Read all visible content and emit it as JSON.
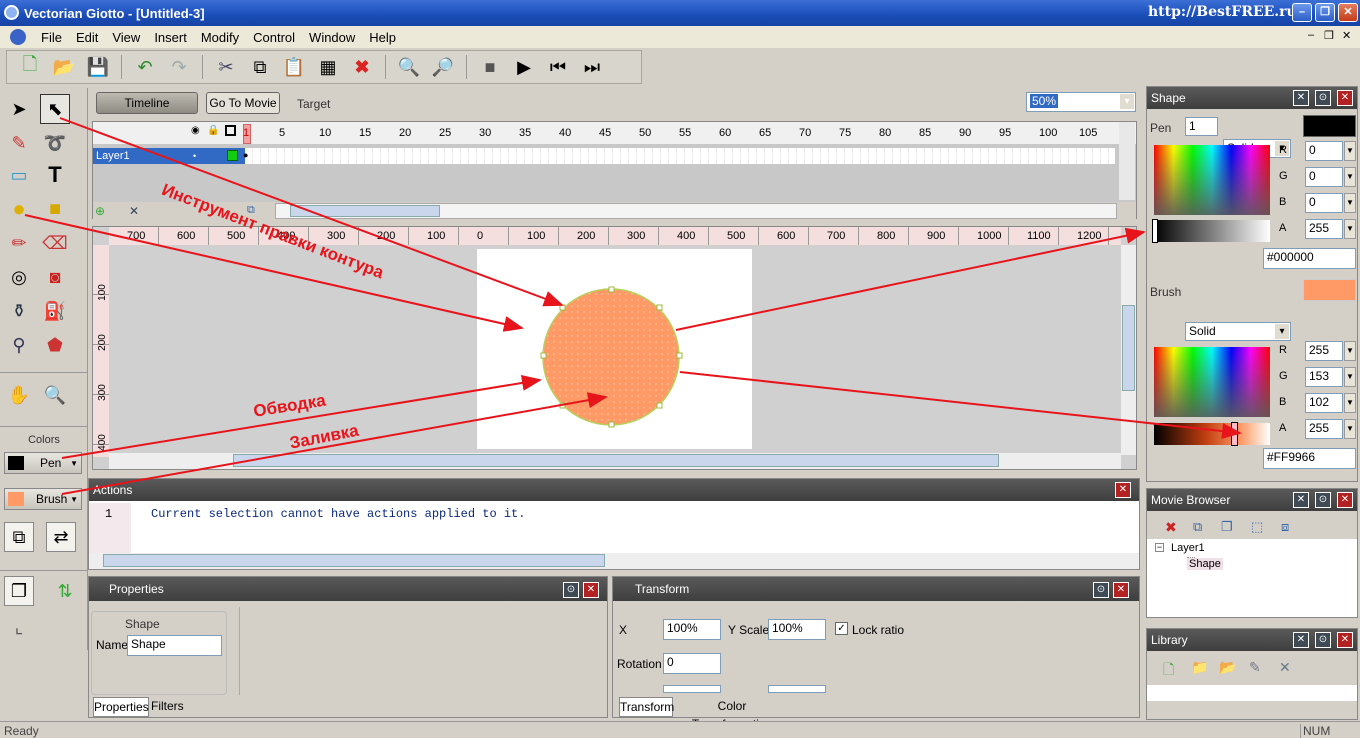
{
  "window": {
    "title": "Vectorian Giotto - [Untitled-3]",
    "watermark": "http://BestFREE.ru"
  },
  "menu": [
    "File",
    "Edit",
    "View",
    "Insert",
    "Modify",
    "Control",
    "Window",
    "Help"
  ],
  "toolbar_icons": [
    "new-file-icon",
    "open-folder-icon",
    "save-icon",
    "undo-icon",
    "redo-icon",
    "cut-icon",
    "copy-icon",
    "paste-icon",
    "paste-special-icon",
    "delete-icon",
    "zoom-in-icon",
    "zoom-out-icon",
    "stop-icon",
    "play-icon",
    "rewind-icon",
    "step-forward-icon"
  ],
  "timeline": {
    "timeline_btn": "Timeline",
    "goto_btn": "Go To Movie",
    "target_label": "Target",
    "zoom": "50%",
    "frame_numbers": [
      "1",
      "5",
      "10",
      "15",
      "20",
      "25",
      "30",
      "35",
      "40",
      "45",
      "50",
      "55",
      "60",
      "65",
      "70",
      "75",
      "80",
      "85",
      "90",
      "95",
      "100",
      "105",
      "1:"
    ],
    "layer_name": "Layer1"
  },
  "ruler_h": [
    "700",
    "600",
    "500",
    "400",
    "300",
    "200",
    "100",
    "0",
    "100",
    "200",
    "300",
    "400",
    "500",
    "600",
    "700",
    "800",
    "900",
    "1000",
    "1100",
    "1200"
  ],
  "ruler_v": [
    "100",
    "200",
    "300",
    "400"
  ],
  "annotations": {
    "contour_tool": "Инструмент правки контура",
    "stroke": "Обводка",
    "fill": "Заливка"
  },
  "colors_panel": {
    "label": "Colors",
    "pen_label": "Pen",
    "brush_label": "Brush",
    "pen_color": "#000000",
    "brush_color": "#FF9966"
  },
  "actions": {
    "title": "Actions",
    "line_no": "1",
    "message": "Current selection cannot have actions applied to it."
  },
  "properties": {
    "title": "Properties",
    "group_label": "Shape",
    "name_label": "Name",
    "name_value": "Shape",
    "tabs": [
      "Properties",
      "Filters"
    ]
  },
  "transform": {
    "title": "Transform",
    "x_label": "X",
    "x_value": "100%",
    "yscale_label": "Y Scale",
    "y_value": "100%",
    "lock_label": "Lock ratio",
    "rotation_label": "Rotation",
    "rotation_value": "0",
    "tabs": [
      "Transform",
      "Color Transformation"
    ]
  },
  "shape_panel": {
    "title": "Shape",
    "pen_label": "Pen",
    "pen_width": "1",
    "pen_style": "Solid",
    "pen_rgba": {
      "R": "0",
      "G": "0",
      "B": "0",
      "A": "255"
    },
    "pen_hex": "#000000",
    "brush_label": "Brush",
    "brush_style": "Solid",
    "brush_rgba": {
      "R": "255",
      "G": "153",
      "B": "102",
      "A": "255"
    },
    "brush_hex": "#FF9966",
    "channel_labels": [
      "R",
      "G",
      "B",
      "A"
    ]
  },
  "movie_browser": {
    "title": "Movie Browser",
    "tree": [
      "Layer1",
      "Shape"
    ]
  },
  "library": {
    "title": "Library"
  },
  "status": {
    "text": "Ready",
    "num": "NUM"
  }
}
